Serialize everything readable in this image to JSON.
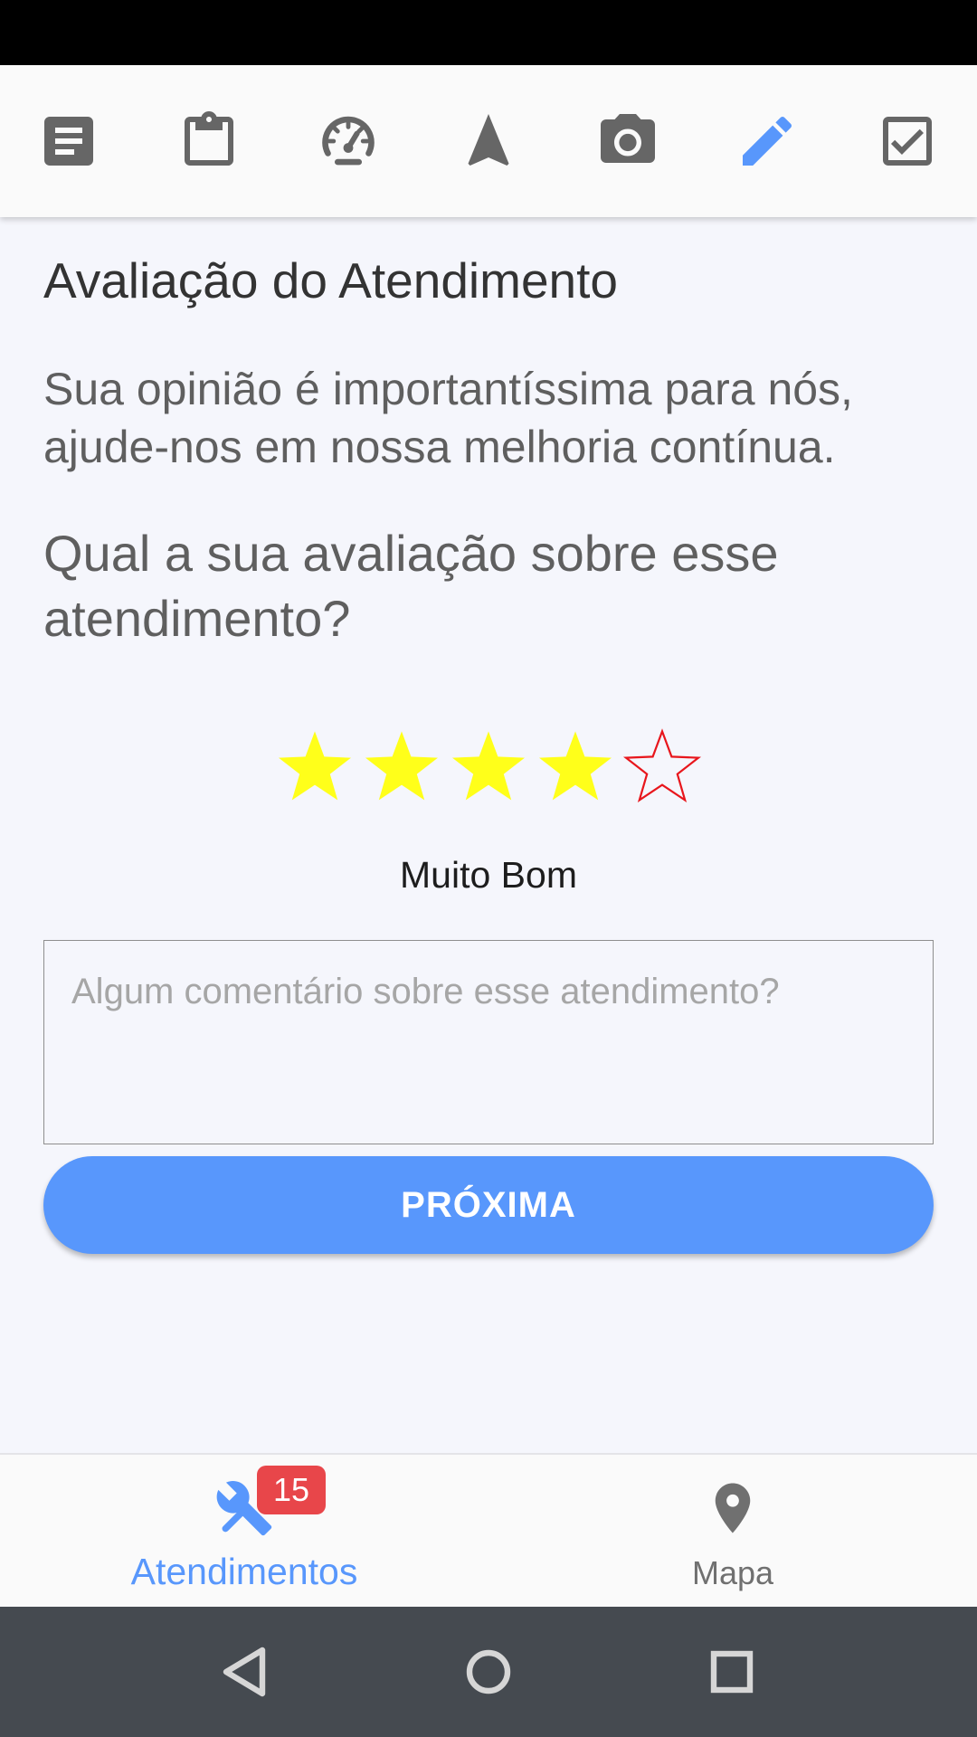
{
  "toolbar": {
    "icons": [
      {
        "name": "document-icon",
        "active": false
      },
      {
        "name": "clipboard-icon",
        "active": false
      },
      {
        "name": "speedometer-icon",
        "active": false
      },
      {
        "name": "navigation-arrow-icon",
        "active": false
      },
      {
        "name": "camera-icon",
        "active": false
      },
      {
        "name": "pencil-icon",
        "active": true
      },
      {
        "name": "checkbox-icon",
        "active": false
      }
    ],
    "icon_color": "#666666",
    "active_color": "#5897fc"
  },
  "main": {
    "title": "Avaliação do Atendimento",
    "intro": "Sua opinião é importantíssima para nós, ajude-nos em nossa melhoria contínua.",
    "question": "Qual a sua avaliação sobre esse atendimento?",
    "rating": {
      "value": 4,
      "max": 5,
      "label": "Muito Bom",
      "filled_color": "#ffff1a",
      "empty_color": "#e8161c"
    },
    "comment": {
      "value": "",
      "placeholder": "Algum comentário sobre esse atendimento?"
    },
    "next_button_label": "PRÓXIMA"
  },
  "bottom_nav": {
    "items": [
      {
        "label": "Atendimentos",
        "icon": "wrench-icon",
        "active": true,
        "badge": "15"
      },
      {
        "label": "Mapa",
        "icon": "map-pin-icon",
        "active": false
      }
    ]
  },
  "system_nav": {
    "buttons": [
      "back-icon",
      "home-icon",
      "recents-icon"
    ]
  }
}
